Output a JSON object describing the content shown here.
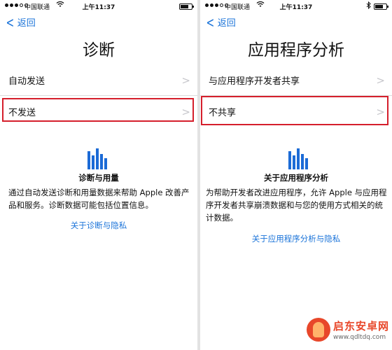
{
  "status_bar": {
    "carrier": "中国联通",
    "time": "上午11:37",
    "battery_level_percent": 75
  },
  "left_screen": {
    "back_label": "返回",
    "title": "诊断",
    "rows": [
      {
        "label": "自动发送"
      },
      {
        "label": "不发送"
      }
    ],
    "section_heading": "诊断与用量",
    "description": "通过自动发送诊断和用量数据来帮助 Apple 改善产品和服务。诊断数据可能包括位置信息。",
    "link": "关于诊断与隐私"
  },
  "right_screen": {
    "back_label": "返回",
    "title": "应用程序分析",
    "rows": [
      {
        "label": "与应用程序开发者共享"
      },
      {
        "label": "不共享"
      }
    ],
    "section_heading": "关于应用程序分析",
    "description": "为帮助开发者改进应用程序，允许 Apple 与应用程序开发者共享崩溃数据和与您的使用方式相关的统计数据。",
    "link": "关于应用程序分析与隐私"
  },
  "watermark": {
    "name": "启东安卓网",
    "url": "www.qdltdq.com"
  },
  "colors": {
    "link_blue": "#1a73d9",
    "highlight_red": "#d51f2c",
    "icon_blue": "#1c6bd6",
    "chevron_gray": "#c7c7cc"
  },
  "icons": {
    "back": "chevron-left-icon",
    "row": "chevron-right-icon",
    "section": "bar-chart-icon",
    "wifi": "wifi-icon",
    "bluetooth": "bluetooth-icon",
    "battery": "battery-icon"
  }
}
